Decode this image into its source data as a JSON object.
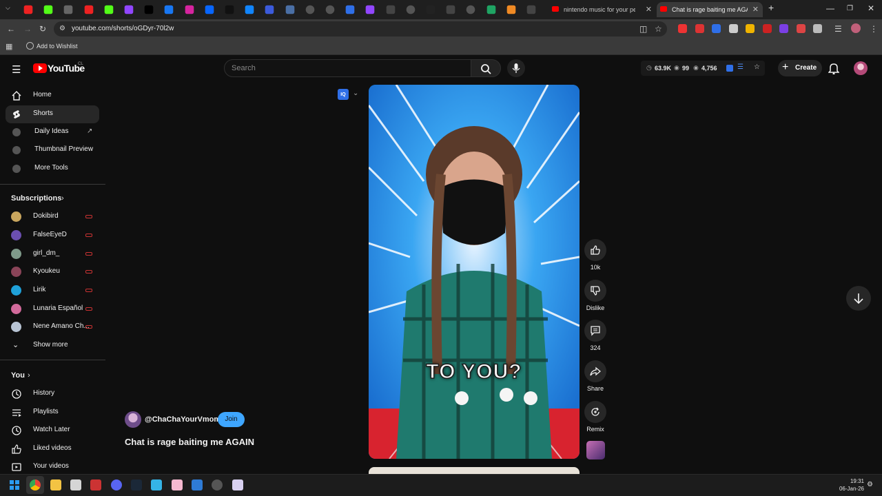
{
  "browser": {
    "pinned_tab_icons": [
      "youtube-icon",
      "kick-icon",
      "chrome-icon",
      "youtube-icon",
      "kick-icon",
      "twitch-icon",
      "x-icon",
      "facebook-icon",
      "instagram-icon",
      "meta-icon",
      "tiktok-icon",
      "bluesky-icon",
      "r-icon",
      "l-icon",
      "clock-icon",
      "globe-icon",
      "vidiq-icon",
      "twitch-icon",
      "tool-icon",
      "globe-icon",
      "terminal-icon",
      "app-icon",
      "globe-icon",
      "drive-icon",
      "orange-icon",
      "tool-icon"
    ],
    "tabs": [
      {
        "title": "nintendo music for your person"
      },
      {
        "title": "Chat is rage baiting me AGAIN"
      }
    ],
    "url": "youtube.com/shorts/oGDyr-70l2w",
    "bookmark_label": "Add to Wishlist",
    "accent": "#ff0000"
  },
  "header": {
    "logo_text": "YouTube",
    "country_code": "CL",
    "search_placeholder": "Search",
    "stat_views": "63.9K",
    "stat_followers": "99",
    "stat_count": "4,756",
    "create_label": "Create"
  },
  "sidebar": {
    "main_items": [
      {
        "label": "Home"
      },
      {
        "label": "Shorts"
      },
      {
        "label": "Daily Ideas"
      },
      {
        "label": "Thumbnail Preview"
      },
      {
        "label": "More Tools"
      }
    ],
    "subscriptions_heading": "Subscriptions",
    "subscriptions": [
      {
        "label": "Dokibird"
      },
      {
        "label": "FalseEyeD"
      },
      {
        "label": "girl_dm_"
      },
      {
        "label": "Kyoukeu"
      },
      {
        "label": "Lirik"
      },
      {
        "label": "Lunaria Español"
      },
      {
        "label": "Nene Amano Ch..."
      }
    ],
    "show_more": "Show more",
    "you_heading": "You",
    "you_items": [
      {
        "label": "History"
      },
      {
        "label": "Playlists"
      },
      {
        "label": "Watch Later"
      },
      {
        "label": "Liked videos"
      },
      {
        "label": "Your videos"
      }
    ]
  },
  "short": {
    "caption_overlay": "TO YOU?",
    "channel": "@ChaChaYourVmom",
    "join_label": "Join",
    "title": "Chat is rage baiting me AGAIN",
    "likes": "10k",
    "dislike_label": "Dislike",
    "comments": "324",
    "share_label": "Share",
    "remix_label": "Remix"
  },
  "taskbar": {
    "time": "19:31",
    "date": "06-Jan-26"
  }
}
